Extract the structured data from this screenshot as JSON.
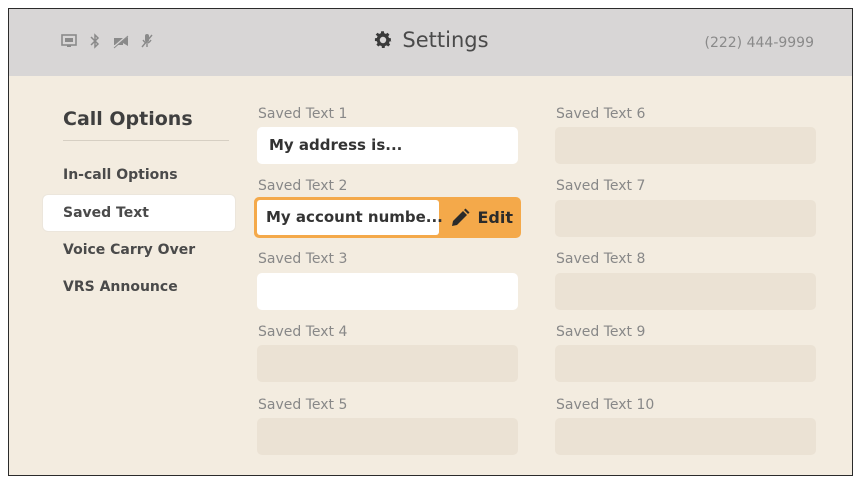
{
  "header": {
    "title": "Settings",
    "phone": "(222) 444-9999",
    "status_icons": [
      "network-icon",
      "bluetooth-icon",
      "video-off-icon",
      "mic-off-icon"
    ]
  },
  "sidebar": {
    "heading": "Call Options",
    "items": [
      {
        "label": "In-call Options"
      },
      {
        "label": "Saved Text",
        "active": true
      },
      {
        "label": "Voice Carry Over"
      },
      {
        "label": "VRS Announce"
      }
    ]
  },
  "fields": {
    "left": [
      {
        "label": "Saved Text 1",
        "value": "My address is..."
      },
      {
        "label": "Saved Text 2",
        "value": "My account numbe...",
        "action": "Edit"
      },
      {
        "label": "Saved Text 3",
        "value": ""
      },
      {
        "label": "Saved Text 4",
        "value": ""
      },
      {
        "label": "Saved Text 5",
        "value": ""
      }
    ],
    "right": [
      {
        "label": "Saved Text 6",
        "value": ""
      },
      {
        "label": "Saved Text 7",
        "value": ""
      },
      {
        "label": "Saved Text 8",
        "value": ""
      },
      {
        "label": "Saved Text 9",
        "value": ""
      },
      {
        "label": "Saved Text 10",
        "value": ""
      }
    ]
  },
  "colors": {
    "background": "#f3ece0",
    "header": "#d8d6d6",
    "accent": "#f4a94a",
    "empty_field": "#ebe2d4"
  }
}
